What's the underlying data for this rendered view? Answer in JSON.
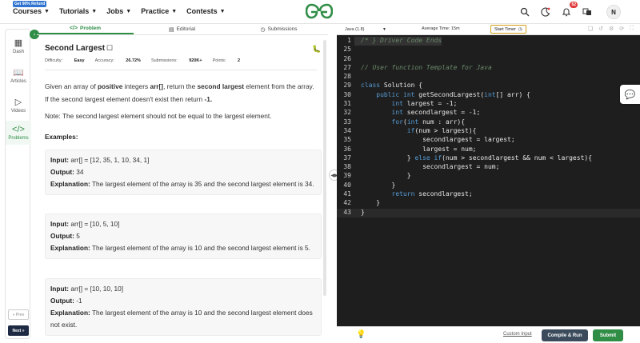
{
  "topnav": {
    "promo_badge": "Get 90% Refund",
    "items": [
      {
        "label": "Courses"
      },
      {
        "label": "Tutorials"
      },
      {
        "label": "Jobs"
      },
      {
        "label": "Practice"
      },
      {
        "label": "Contests"
      }
    ],
    "notifications_count": "52",
    "avatar_initial": "N",
    "brand_color": "#2f8d46"
  },
  "rail": {
    "items": [
      {
        "label": "Dash",
        "icon": "dashboard-icon"
      },
      {
        "label": "Articles",
        "icon": "book-icon"
      },
      {
        "label": "Videos",
        "icon": "play-icon"
      },
      {
        "label": "Problems",
        "icon": "code-icon"
      }
    ],
    "prev_label": "« Prev",
    "next_label": "Next »"
  },
  "tabs": [
    {
      "label": "Problem"
    },
    {
      "label": "Editorial"
    },
    {
      "label": "Submissions"
    }
  ],
  "problem": {
    "title": "Second Largest",
    "difficulty_label": "Difficulty:",
    "difficulty": "Easy",
    "accuracy_label": "Accuracy:",
    "accuracy": "26.72%",
    "submissions_label": "Submissions:",
    "submissions": "920K+",
    "points_label": "Points:",
    "points": "2",
    "desc_1": "Given an array of ",
    "desc_b1": "positive",
    "desc_2": " integers ",
    "desc_b2": "arr[]",
    "desc_3": ", return the ",
    "desc_b3": "second largest",
    "desc_4": " element from the array. If the second largest element doesn't exist then return ",
    "desc_b4": "-1.",
    "note": "Note: The second largest element should not be equal to the largest element.",
    "examples_heading": "Examples:",
    "examples": [
      {
        "input": "arr[] = [12, 35, 1, 10, 34, 1]",
        "output": "34",
        "explanation": "The largest element of the array is 35 and the second largest element is 34."
      },
      {
        "input": "arr[] = [10, 5, 10]",
        "output": "5",
        "explanation": "The largest element of the array is 10 and the second largest element is 5."
      },
      {
        "input": "arr[] = [10, 10, 10]",
        "output": "-1",
        "explanation": "The largest element of the array is 10 and the second largest element does not exist."
      }
    ],
    "input_label": "Input:",
    "output_label": "Output:",
    "explanation_label": "Explanation:"
  },
  "editor": {
    "language": "Java (1.8)",
    "avg_time": "Average Time: 15m",
    "timer_label": "Start Timer",
    "lines": [
      {
        "n": "1",
        "text": "/* } Driver Code Ends"
      },
      {
        "n": "25",
        "text": ""
      },
      {
        "n": "26",
        "text": ""
      },
      {
        "n": "27",
        "text": "// User function Template for Java"
      },
      {
        "n": "28",
        "text": ""
      },
      {
        "n": "29",
        "text": "class Solution {"
      },
      {
        "n": "30",
        "text": "    public int getSecondLargest(int[] arr) {"
      },
      {
        "n": "31",
        "text": "        int largest = -1;"
      },
      {
        "n": "32",
        "text": "        int secondlargest = -1;"
      },
      {
        "n": "33",
        "text": "        for(int num : arr){"
      },
      {
        "n": "34",
        "text": "            if(num > largest){"
      },
      {
        "n": "35",
        "text": "                secondlargest = largest;"
      },
      {
        "n": "36",
        "text": "                largest = num;"
      },
      {
        "n": "37",
        "text": "            } else if(num > secondlargest && num < largest){"
      },
      {
        "n": "38",
        "text": "                secondlargest = num;"
      },
      {
        "n": "39",
        "text": "            }"
      },
      {
        "n": "40",
        "text": "        }"
      },
      {
        "n": "41",
        "text": "        return secondlargest;"
      },
      {
        "n": "42",
        "text": "    }"
      },
      {
        "n": "43",
        "text": "}"
      }
    ],
    "custom_input": "Custom Input",
    "compile_label": "Compile & Run",
    "submit_label": "Submit"
  }
}
